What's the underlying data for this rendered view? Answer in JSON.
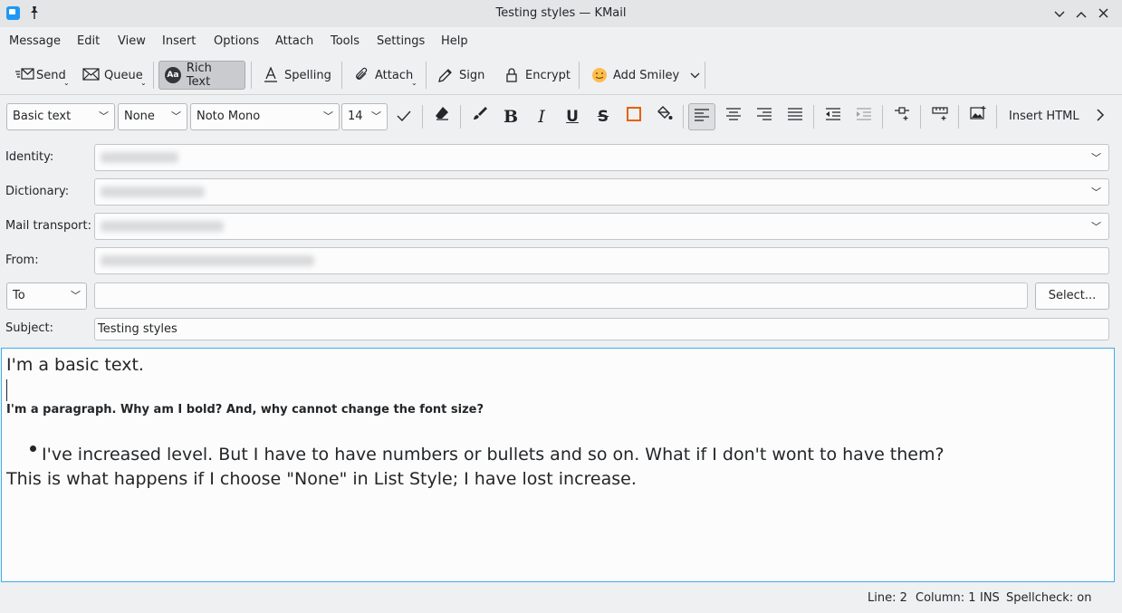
{
  "window": {
    "title": "Testing styles — KMail"
  },
  "titlebar_icons": {
    "app": "kmail-app-icon",
    "pin": "pin-icon",
    "minimize": "chevron-down-icon",
    "maximize": "chevron-up-icon",
    "close": "close-icon"
  },
  "menu": [
    "Message",
    "Edit",
    "View",
    "Insert",
    "Options",
    "Attach",
    "Tools",
    "Settings",
    "Help"
  ],
  "toolbar": {
    "send": "Send",
    "queue": "Queue",
    "rich_text": "Rich Text",
    "rich_text_badge": "Aa",
    "spelling": "Spelling",
    "attach": "Attach",
    "sign": "Sign",
    "encrypt": "Encrypt",
    "add_smiley": "Add Smiley"
  },
  "format": {
    "paragraph_style": "Basic text",
    "list_style": "None",
    "font": "Noto Mono",
    "font_size": "14",
    "insert_html": "Insert HTML"
  },
  "fields": {
    "identity_label": "Identity:",
    "dictionary_label": "Dictionary:",
    "transport_label": "Mail transport:",
    "from_label": "From:",
    "to_type": "To",
    "to_value": "",
    "select_button": "Select...",
    "subject_label": "Subject:",
    "subject_value": "Testing styles"
  },
  "body": {
    "line1": "I'm a basic text.",
    "line2": "I'm a paragraph. Why am I bold? And, why cannot change the font size?",
    "bullet": "I've increased level. But I have to have numbers or bullets and so on. What if I don't wont to have them?",
    "line4": "This is what happens if I choose \"None\" in List Style; I have lost increase."
  },
  "status": {
    "line": "Line: 2",
    "column": "Column: 1",
    "mode": "INS",
    "spellcheck": "Spellcheck: on"
  },
  "colors": {
    "accent": "#3daee9",
    "window_bg": "#eff0f1",
    "titlebar_bg": "#e3e5e7"
  }
}
